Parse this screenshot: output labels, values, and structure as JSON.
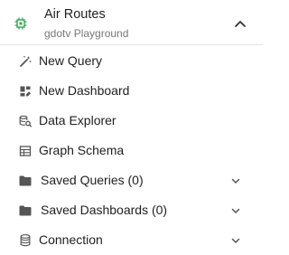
{
  "header": {
    "title": "Air Routes",
    "subtitle": "gdotv Playground",
    "icon": "database-chip-icon",
    "accent": "#2aa84a"
  },
  "menu": {
    "items": [
      {
        "label": "New Query",
        "icon": "magic-wand-icon"
      },
      {
        "label": "New Dashboard",
        "icon": "dashboard-icon"
      },
      {
        "label": "Data Explorer",
        "icon": "data-search-icon"
      },
      {
        "label": "Graph Schema",
        "icon": "table-schema-icon"
      },
      {
        "label": "Saved Queries (0)",
        "icon": "folder-icon",
        "expandable": true
      },
      {
        "label": "Saved Dashboards (0)",
        "icon": "folder-icon",
        "expandable": true
      },
      {
        "label": "Connection",
        "icon": "database-icon",
        "expandable": true
      }
    ]
  }
}
